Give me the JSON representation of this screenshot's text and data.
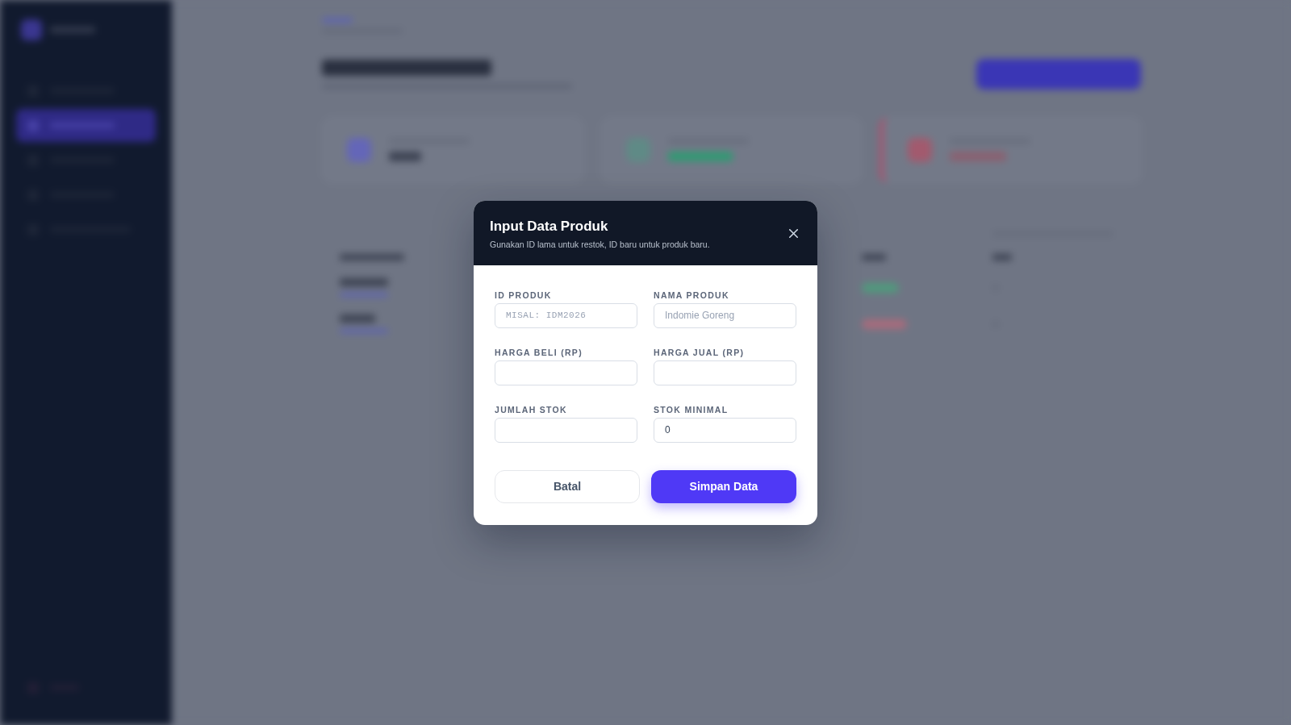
{
  "modal": {
    "title": "Input Data Produk",
    "subtitle": "Gunakan ID lama untuk restok, ID baru untuk produk baru.",
    "fields": [
      {
        "label": "ID PRODUK",
        "placeholder": "MISAL: IDM2026",
        "kind": "code"
      },
      {
        "label": "NAMA PRODUK",
        "placeholder": "Indomie Goreng",
        "kind": "text"
      },
      {
        "label": "HARGA BELI (RP)",
        "kind": "text"
      },
      {
        "label": "HARGA JUAL (RP)",
        "kind": "text"
      },
      {
        "label": "JUMLAH STOK",
        "kind": "text"
      },
      {
        "label": "STOK MINIMAL",
        "value": "0",
        "kind": "text"
      }
    ],
    "buttons": [
      {
        "label": "Batal",
        "kind": "secondary"
      },
      {
        "label": "Simpan Data",
        "kind": "primary"
      }
    ]
  }
}
